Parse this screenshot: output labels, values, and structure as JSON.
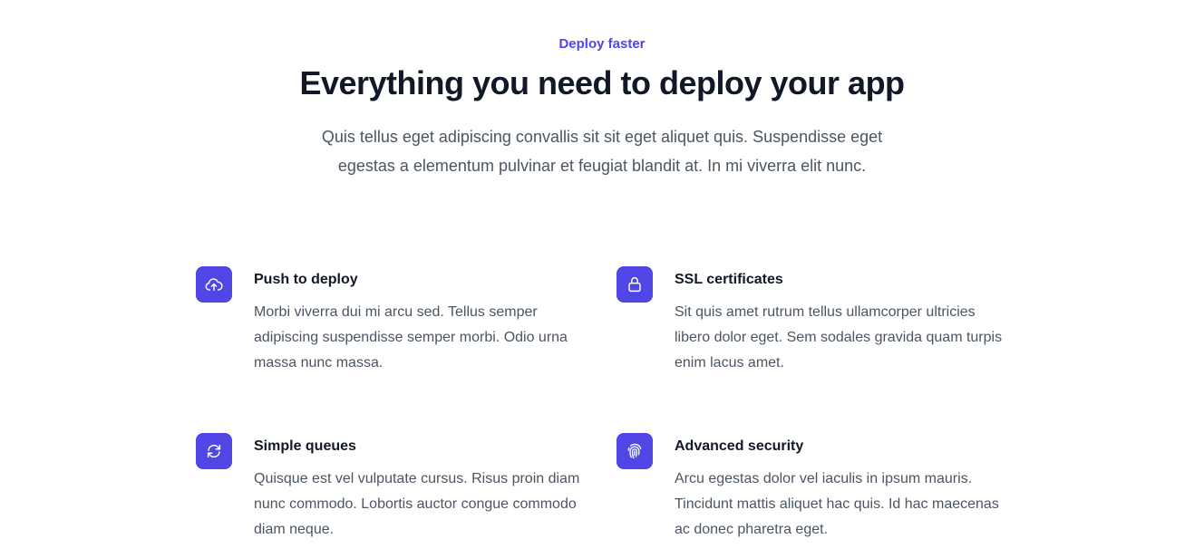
{
  "header": {
    "eyebrow": "Deploy faster",
    "title": "Everything you need to deploy your app",
    "subtitle": "Quis tellus eget adipiscing convallis sit sit eget aliquet quis. Suspendisse eget egestas a elementum pulvinar et feugiat blandit at. In mi viverra elit nunc."
  },
  "features": [
    {
      "icon": "cloud-arrow-up-icon",
      "title": "Push to deploy",
      "description": "Morbi viverra dui mi arcu sed. Tellus semper adipiscing suspendisse semper morbi. Odio urna massa nunc massa."
    },
    {
      "icon": "lock-icon",
      "title": "SSL certificates",
      "description": "Sit quis amet rutrum tellus ullamcorper ultricies libero dolor eget. Sem sodales gravida quam turpis enim lacus amet."
    },
    {
      "icon": "refresh-icon",
      "title": "Simple queues",
      "description": "Quisque est vel vulputate cursus. Risus proin diam nunc commodo. Lobortis auctor congue commodo diam neque."
    },
    {
      "icon": "fingerprint-icon",
      "title": "Advanced security",
      "description": "Arcu egestas dolor vel iaculis in ipsum mauris. Tincidunt mattis aliquet hac quis. Id hac maecenas ac donec pharetra eget."
    }
  ],
  "colors": {
    "accent": "#4f46e5",
    "heading": "#111827",
    "body_text": "#4b5563",
    "background": "#ffffff"
  }
}
